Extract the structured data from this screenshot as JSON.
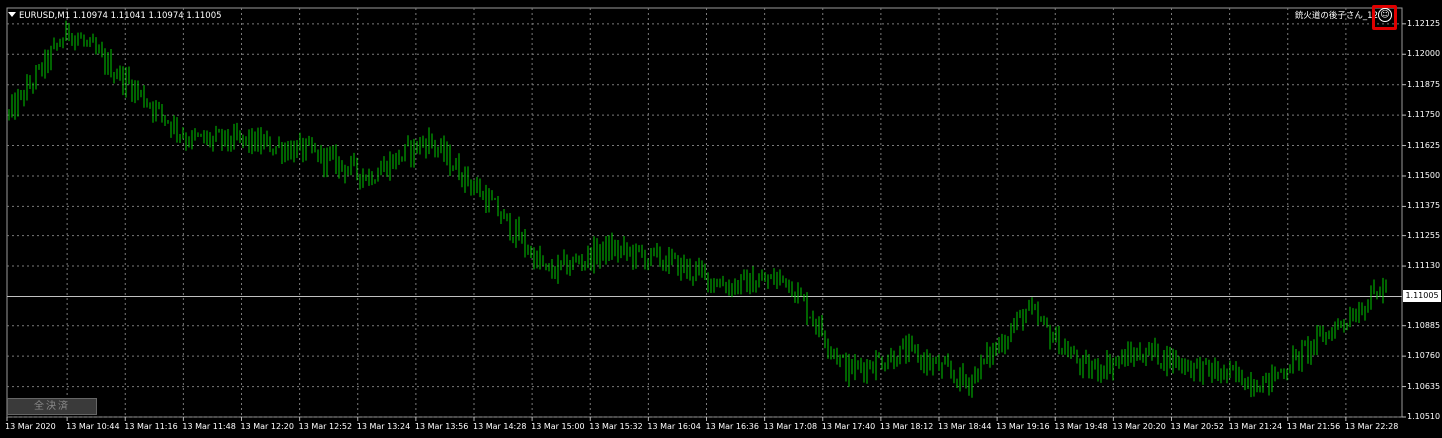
{
  "symbol_info": {
    "text": "EURUSD,M1  1.10974 1.11041 1.10974 1.11005"
  },
  "ea": {
    "label": "銃火道の後子さん_12",
    "icon": "smiley-face-icon"
  },
  "price_axis": {
    "labels": [
      "1.12125",
      "1.12000",
      "1.11875",
      "1.11750",
      "1.11625",
      "1.11500",
      "1.11375",
      "1.11255",
      "1.11130",
      "1.10885",
      "1.10760",
      "1.10635",
      "1.10510"
    ],
    "current_price": "1.11005"
  },
  "time_axis": {
    "labels": [
      "13 Mar 2020",
      "13 Mar 10:44",
      "13 Mar 11:16",
      "13 Mar 11:48",
      "13 Mar 12:20",
      "13 Mar 12:52",
      "13 Mar 13:24",
      "13 Mar 13:56",
      "13 Mar 14:28",
      "13 Mar 15:00",
      "13 Mar 15:32",
      "13 Mar 16:04",
      "13 Mar 16:36",
      "13 Mar 17:08",
      "13 Mar 17:40",
      "13 Mar 18:12",
      "13 Mar 18:44",
      "13 Mar 19:16",
      "13 Mar 19:48",
      "13 Mar 20:20",
      "13 Mar 20:52",
      "13 Mar 21:24",
      "13 Mar 21:56",
      "13 Mar 22:28"
    ]
  },
  "close_all_button": {
    "label": "全決済"
  },
  "colors": {
    "background": "#000000",
    "bars": "#00c800",
    "grid": "#7a7a7a",
    "current_price_line": "#c0c0c0",
    "highlight": "#e00000"
  },
  "chart_data": {
    "type": "line",
    "symbol": "EURUSD",
    "timeframe": "M1",
    "ylim": [
      1.1051,
      1.1219
    ],
    "x": [
      "13 Mar 2020",
      "13 Mar 10:44",
      "13 Mar 11:16",
      "13 Mar 11:48",
      "13 Mar 12:20",
      "13 Mar 12:52",
      "13 Mar 13:24",
      "13 Mar 13:56",
      "13 Mar 14:28",
      "13 Mar 15:00",
      "13 Mar 15:32",
      "13 Mar 16:04",
      "13 Mar 16:36",
      "13 Mar 17:08",
      "13 Mar 17:40",
      "13 Mar 18:12",
      "13 Mar 18:44",
      "13 Mar 19:16",
      "13 Mar 19:48",
      "13 Mar 20:20",
      "13 Mar 20:52",
      "13 Mar 21:24",
      "13 Mar 21:56",
      "13 Mar 22:28"
    ],
    "series": [
      {
        "values": [
          1.1175,
          1.121,
          1.1188,
          1.1165,
          1.1164,
          1.116,
          1.115,
          1.1165,
          1.114,
          1.111,
          1.112,
          1.1115,
          1.1105,
          1.1108,
          1.107,
          1.1078,
          1.1065,
          1.1095,
          1.107,
          1.1078,
          1.107,
          1.1065,
          1.1085,
          1.1105
        ]
      }
    ],
    "grid": true,
    "current_price": 1.11005
  }
}
